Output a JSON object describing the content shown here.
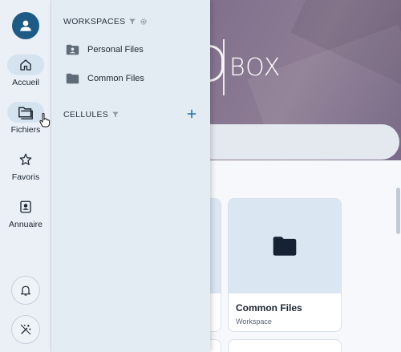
{
  "banner": {
    "logo_text": "BOX"
  },
  "rail": {
    "items": [
      {
        "label": "Accueil",
        "icon": "home-icon"
      },
      {
        "label": "Fichiers",
        "icon": "folder-icon"
      },
      {
        "label": "Favoris",
        "icon": "star-icon"
      },
      {
        "label": "Annuaire",
        "icon": "contact-card-icon"
      }
    ],
    "bottom_buttons": [
      "bell-icon",
      "magic-wand-icon"
    ]
  },
  "drawer": {
    "workspaces_header": "WORKSPACES",
    "workspaces": [
      {
        "label": "Personal Files",
        "icon": "person-folder-icon"
      },
      {
        "label": "Common Files",
        "icon": "folder-icon"
      }
    ],
    "cells_header": "CELLULES"
  },
  "cards": [
    {
      "title": "Common Files",
      "subtitle": "Workspace",
      "icon": "folder-icon"
    }
  ],
  "colors": {
    "accent": "#1d5b86",
    "rail_bg": "#eaf0f6",
    "drawer_bg": "#e4ecf3",
    "banner": "#8a7a94",
    "add_icon": "#1f6fb5"
  }
}
